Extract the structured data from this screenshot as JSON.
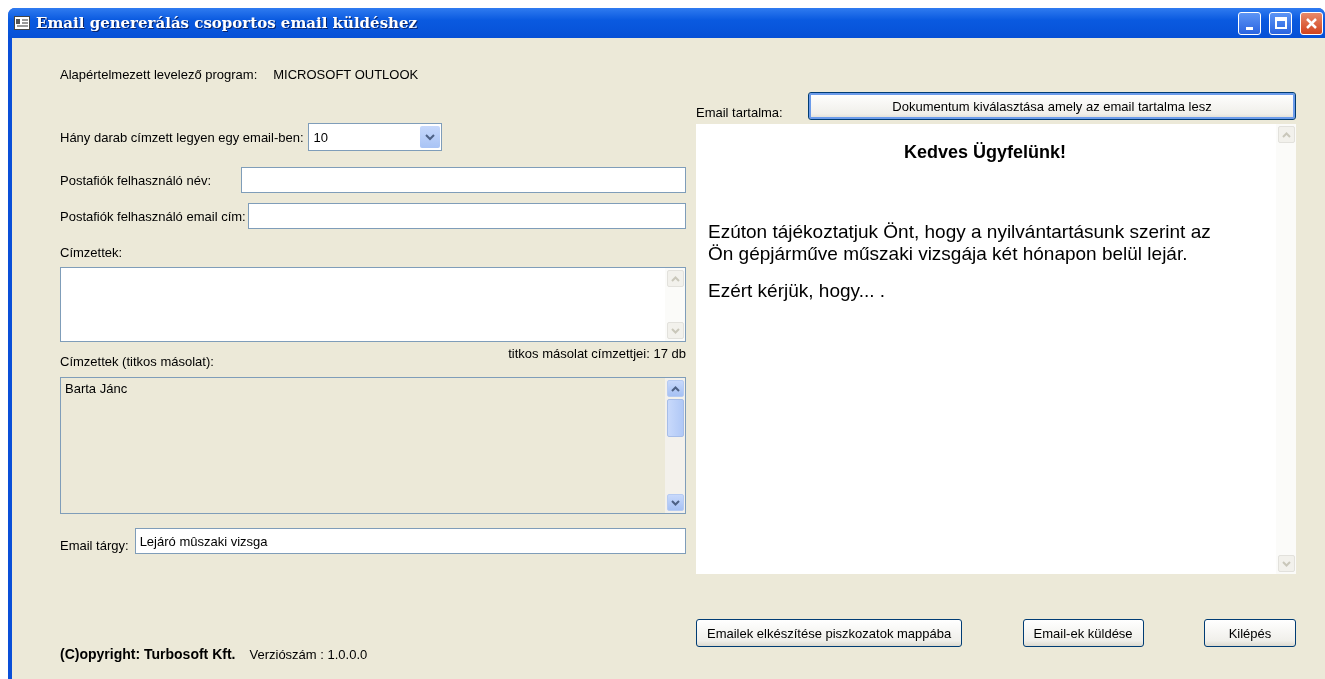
{
  "window": {
    "title": "Email genererálás csoportos email küldéshez"
  },
  "default_program": {
    "label": "Alapértelmezett levelező program:",
    "value": "MICROSOFT OUTLOOK"
  },
  "recipients_per_email": {
    "label": "Hány darab címzett legyen egy email-ben:",
    "value": "10"
  },
  "text_fields": [
    {
      "label": "Postafiók felhasználó név:"
    },
    {
      "label": "Postafiók felhasználó email cím:"
    }
  ],
  "recipients": {
    "label": "Címzettek:"
  },
  "bcc": {
    "label": "Címzettek (titkos másolat):",
    "count": "titkos másolat címzettjei: 17 db",
    "lines": [
      "Barta Jánc"
    ]
  },
  "subject": {
    "label": "Email tárgy:",
    "value": "Lejáró mûszaki vizsga"
  },
  "email_content": {
    "label": "Email tartalma:",
    "choose_button": "Dokumentum kiválasztása amely az email tartalma lesz",
    "heading": "Kedves Ügyfelünk!",
    "paragraphs": [
      "Ezúton tájékoztatjuk Önt, hogy a nyilvántartásunk szerint az Ön gépjárműve műszaki vizsgája két hónapon belül lejár.",
      "Ezért kérjük, hogy... ."
    ]
  },
  "footer": {
    "copyright": "(C)opyright: Turbosoft Kft.",
    "version": "Verziószám : 1.0.0.0"
  },
  "buttons": [
    "Emailek elkészítése piszkozatok mappába",
    "Email-ek küldése",
    "Kilépés"
  ]
}
